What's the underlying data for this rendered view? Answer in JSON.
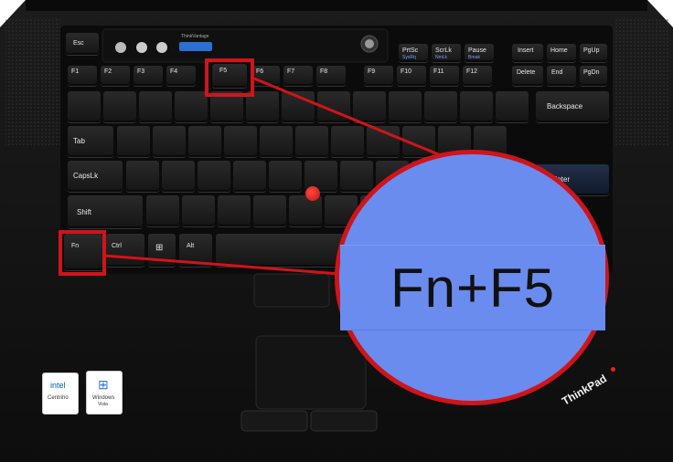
{
  "caption": "Fn+F5",
  "keys": {
    "esc": "Esc",
    "prtsc": "PrtSc",
    "sysrq": "SysRq",
    "scrlk": "ScrLk",
    "numlk": "NmLk",
    "pause": "Pause",
    "break": "Break",
    "insert": "Insert",
    "home": "Home",
    "pgup": "PgUp",
    "delete": "Delete",
    "end": "End",
    "pgdn": "PgDn",
    "f1": "F1",
    "f2": "F2",
    "f3": "F3",
    "f4": "F4",
    "f5": "F5",
    "f6": "F6",
    "f7": "F7",
    "f8": "F8",
    "f9": "F9",
    "f10": "F10",
    "f11": "F11",
    "f12": "F12",
    "backspace": "Backspace",
    "tab": "Tab",
    "capslock": "CapsLk",
    "shift": "Shift",
    "enter": "Enter",
    "fn": "Fn",
    "ctrl": "Ctrl",
    "alt": "Alt",
    "thinkvantage": "ThinkVantage"
  },
  "brand": {
    "thinkpad": "ThinkPad",
    "intel": "intel",
    "centrino": "Centrino",
    "windows": "Windows",
    "vista": "Vista"
  },
  "colors": {
    "highlight": "#d0141a",
    "circle": "#6b8cef",
    "trackpoint": "#e2231a"
  }
}
